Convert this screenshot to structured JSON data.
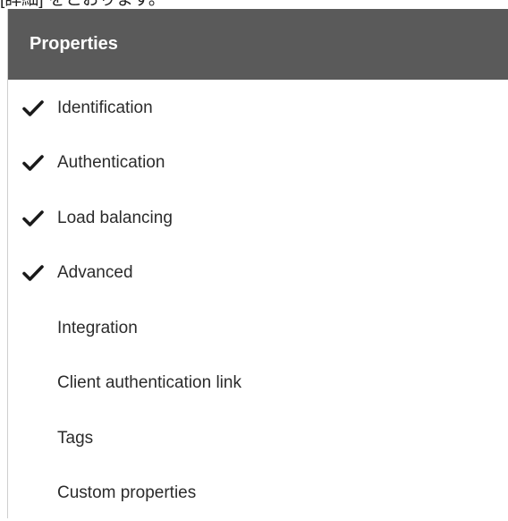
{
  "page_top_text": "[詳細] をとおります。",
  "panel": {
    "title": "Properties"
  },
  "nav": {
    "items": [
      {
        "label": "Identification",
        "checked": true,
        "icon": "checkmark-icon"
      },
      {
        "label": "Authentication",
        "checked": true,
        "icon": "checkmark-icon"
      },
      {
        "label": "Load balancing",
        "checked": true,
        "icon": "checkmark-icon"
      },
      {
        "label": "Advanced",
        "checked": true,
        "icon": "checkmark-icon"
      },
      {
        "label": "Integration",
        "checked": false
      },
      {
        "label": "Client authentication link",
        "checked": false
      },
      {
        "label": "Tags",
        "checked": false
      },
      {
        "label": "Custom properties",
        "checked": false
      }
    ]
  },
  "colors": {
    "header_bg": "#5a5a5a",
    "header_text": "#ffffff",
    "item_text": "#2b2b2b",
    "check": "#1a1a1a"
  }
}
